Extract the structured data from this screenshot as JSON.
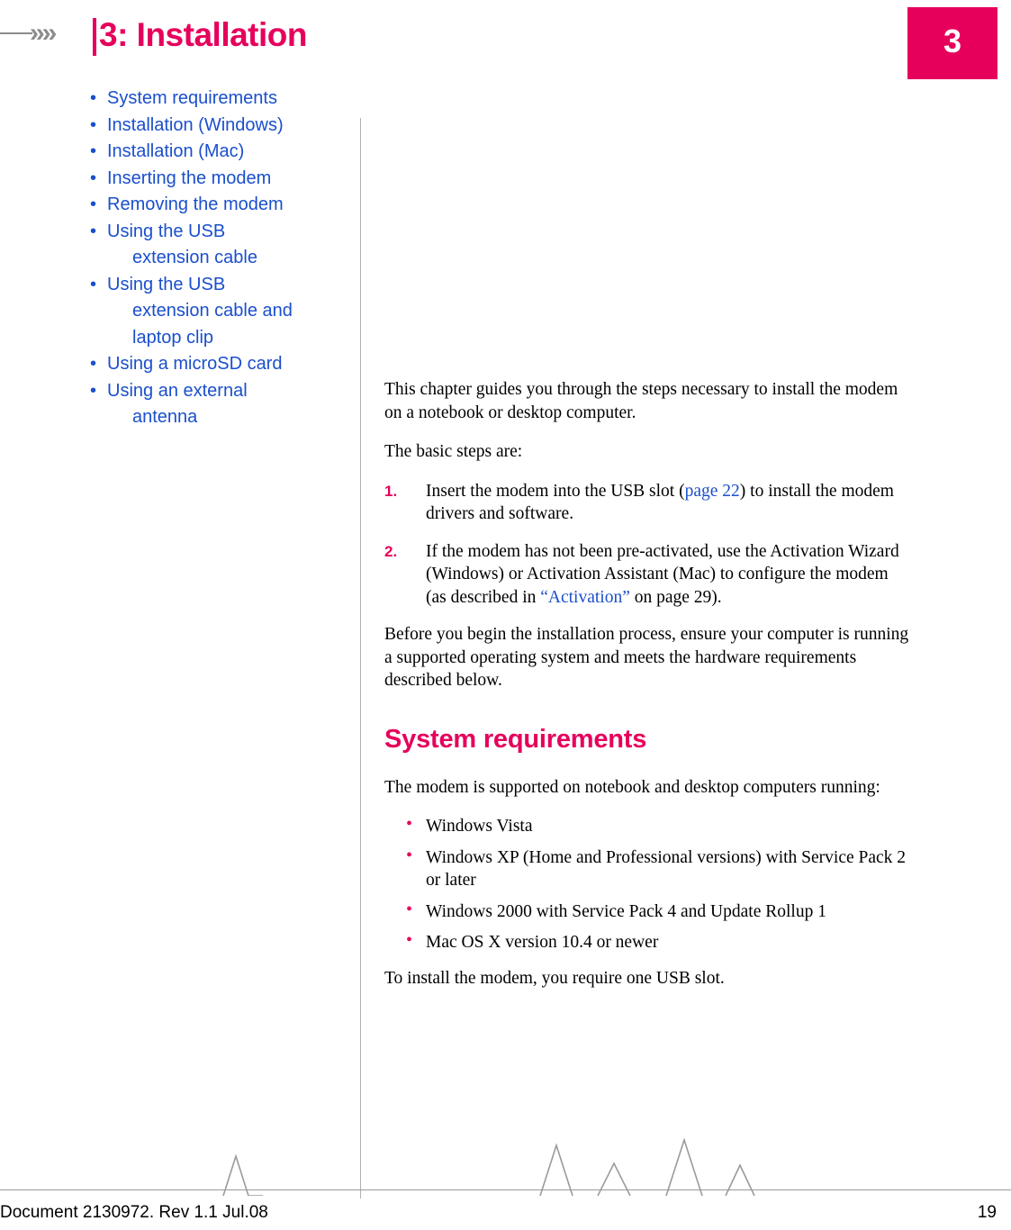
{
  "header": {
    "chapter_title": "3: Installation",
    "chapter_number": "3",
    "chevrons": "»»"
  },
  "toc": {
    "items": [
      {
        "label": "System requirements"
      },
      {
        "label": "Installation (Windows)"
      },
      {
        "label": "Installation (Mac)"
      },
      {
        "label": "Inserting the modem"
      },
      {
        "label": "Removing the modem"
      },
      {
        "label": "Using the USB",
        "cont": "extension cable"
      },
      {
        "label": "Using the USB",
        "cont": "extension cable and",
        "cont2": "laptop clip"
      },
      {
        "label": "Using a microSD card"
      },
      {
        "label": "Using an external",
        "cont": "antenna"
      }
    ]
  },
  "main": {
    "intro": "This chapter guides you through the steps necessary to install the modem on a notebook or desktop computer.",
    "basic_steps_lead": "The basic steps are:",
    "steps": [
      {
        "num": "1.",
        "part1": "Insert the modem into the USB slot (",
        "link": "page 22",
        "part2": ") to install the modem drivers and software."
      },
      {
        "num": "2.",
        "part1": "If the modem has not been pre-activated, use the Activation Wizard (Windows) or Activation Assistant (Mac) to configure the modem (as described in ",
        "link": "“Activation”",
        "part2": " on page 29)."
      }
    ],
    "before_you_begin": "Before you begin the installation process, ensure your computer is running a supported operating system and meets the hardware requirements described below.",
    "section_heading": "System requirements",
    "supported_lead": "The modem is supported on notebook and desktop computers running:",
    "os_list": [
      "Windows Vista",
      "Windows XP (Home and Professional versions) with Service Pack 2 or later",
      "Windows 2000 with Service Pack 4 and Update Rollup 1",
      "Mac OS X version 10.4 or newer"
    ],
    "closing": "To install the modem, you require one USB slot."
  },
  "footer": {
    "document": "Document 2130972. Rev 1.1  Jul.08",
    "page_number": "19"
  }
}
